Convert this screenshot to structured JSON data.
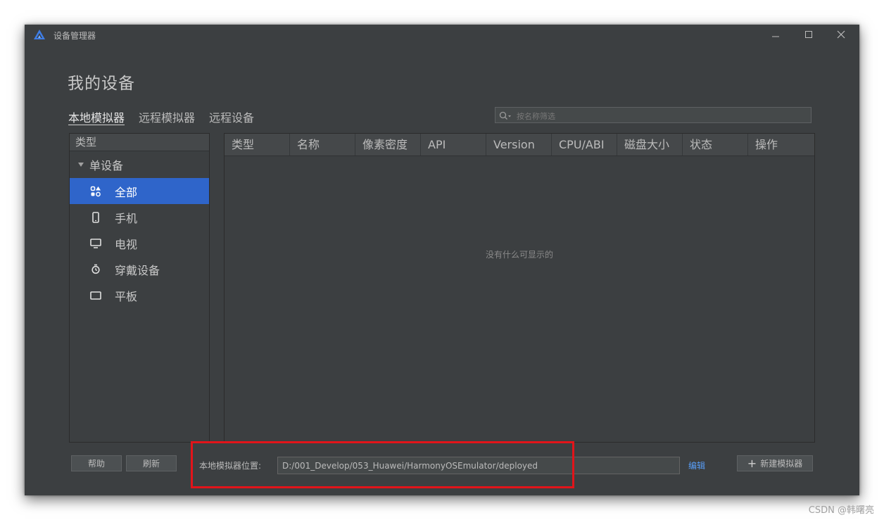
{
  "window": {
    "title": "设备管理器",
    "controls": [
      "minimize-icon",
      "maximize-icon",
      "close-icon"
    ]
  },
  "page": {
    "title": "我的设备"
  },
  "tabs": [
    {
      "label": "本地模拟器",
      "active": true
    },
    {
      "label": "远程模拟器",
      "active": false
    },
    {
      "label": "远程设备",
      "active": false
    }
  ],
  "search": {
    "placeholder": "按名称筛选",
    "value": "",
    "icon": "search-icon"
  },
  "sidebar": {
    "header": "类型",
    "group": {
      "label": "单设备",
      "expanded": true
    },
    "items": [
      {
        "label": "全部",
        "icon": "grid-icon",
        "selected": true
      },
      {
        "label": "手机",
        "icon": "phone-icon",
        "selected": false
      },
      {
        "label": "电视",
        "icon": "tv-icon",
        "selected": false
      },
      {
        "label": "穿戴设备",
        "icon": "watch-icon",
        "selected": false
      },
      {
        "label": "平板",
        "icon": "tablet-icon",
        "selected": false
      }
    ]
  },
  "table": {
    "columns": [
      "类型",
      "名称",
      "像素密度",
      "API",
      "Version",
      "CPU/ABI",
      "磁盘大小",
      "状态",
      "操作"
    ],
    "rows": [],
    "empty_text": "没有什么可显示的"
  },
  "footer": {
    "help_label": "帮助",
    "refresh_label": "刷新",
    "location_label": "本地模拟器位置:",
    "location_value": "D:/001_Develop/053_Huawei/HarmonyOSEmulator/deployed",
    "edit_label": "编辑",
    "new_emulator_label": "新建模拟器"
  },
  "watermark": "CSDN @韩曙亮",
  "colors": {
    "background": "#3c3f41",
    "selection": "#2f65ca",
    "link": "#589df6",
    "highlight": "#e2141a"
  }
}
